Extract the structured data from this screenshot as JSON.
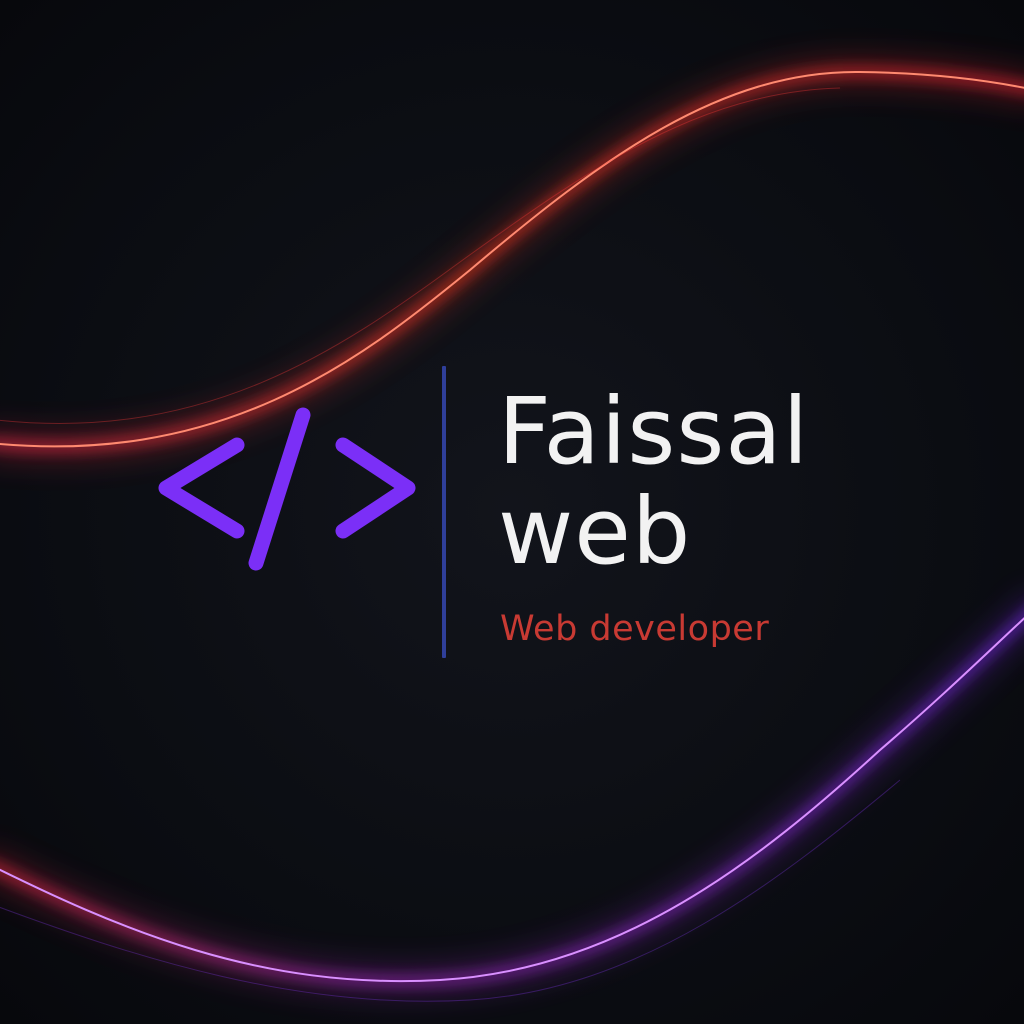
{
  "brand": {
    "name_line1": "Faissal",
    "name_line2": "web",
    "tagline": "Web developer"
  },
  "icons": {
    "logo": "code-brackets-icon"
  },
  "colors": {
    "background": "#0b0d13",
    "logo": "#7b2ff7",
    "name_text": "#f2f2f2",
    "tagline_text": "#c83a33",
    "divider": "#2f3f9a",
    "wave_warm": "#ff3b1f",
    "wave_cool": "#8a2be2"
  }
}
